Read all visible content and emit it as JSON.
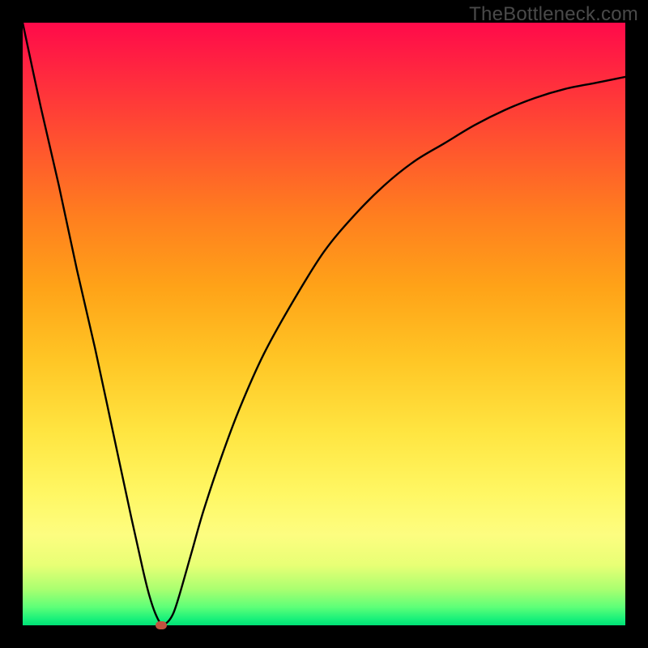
{
  "watermark": "TheBottleneck.com",
  "colors": {
    "frame": "#000000",
    "curve": "#000000",
    "marker": "#c1513f"
  },
  "chart_data": {
    "type": "line",
    "title": "",
    "xlabel": "",
    "ylabel": "",
    "xlim": [
      0,
      100
    ],
    "ylim": [
      0,
      100
    ],
    "grid": false,
    "x": [
      0,
      3,
      6,
      9,
      12,
      15,
      18,
      20,
      21,
      22,
      23,
      24,
      25,
      26,
      28,
      30,
      33,
      36,
      40,
      45,
      50,
      55,
      60,
      65,
      70,
      75,
      80,
      85,
      90,
      95,
      100
    ],
    "values": [
      100,
      86,
      73,
      59,
      46,
      32,
      18,
      9,
      5,
      2,
      0.2,
      0.5,
      2,
      5,
      12,
      19,
      28,
      36,
      45,
      54,
      62,
      68,
      73,
      77,
      80,
      83,
      85.5,
      87.5,
      89,
      90,
      91
    ],
    "marker": {
      "x": 23,
      "y": 0
    },
    "notes": "V-shaped bottleneck curve. Minimum near x≈23. y-axis inverted visually (0 at bottom = green, 100 at top = red)."
  }
}
